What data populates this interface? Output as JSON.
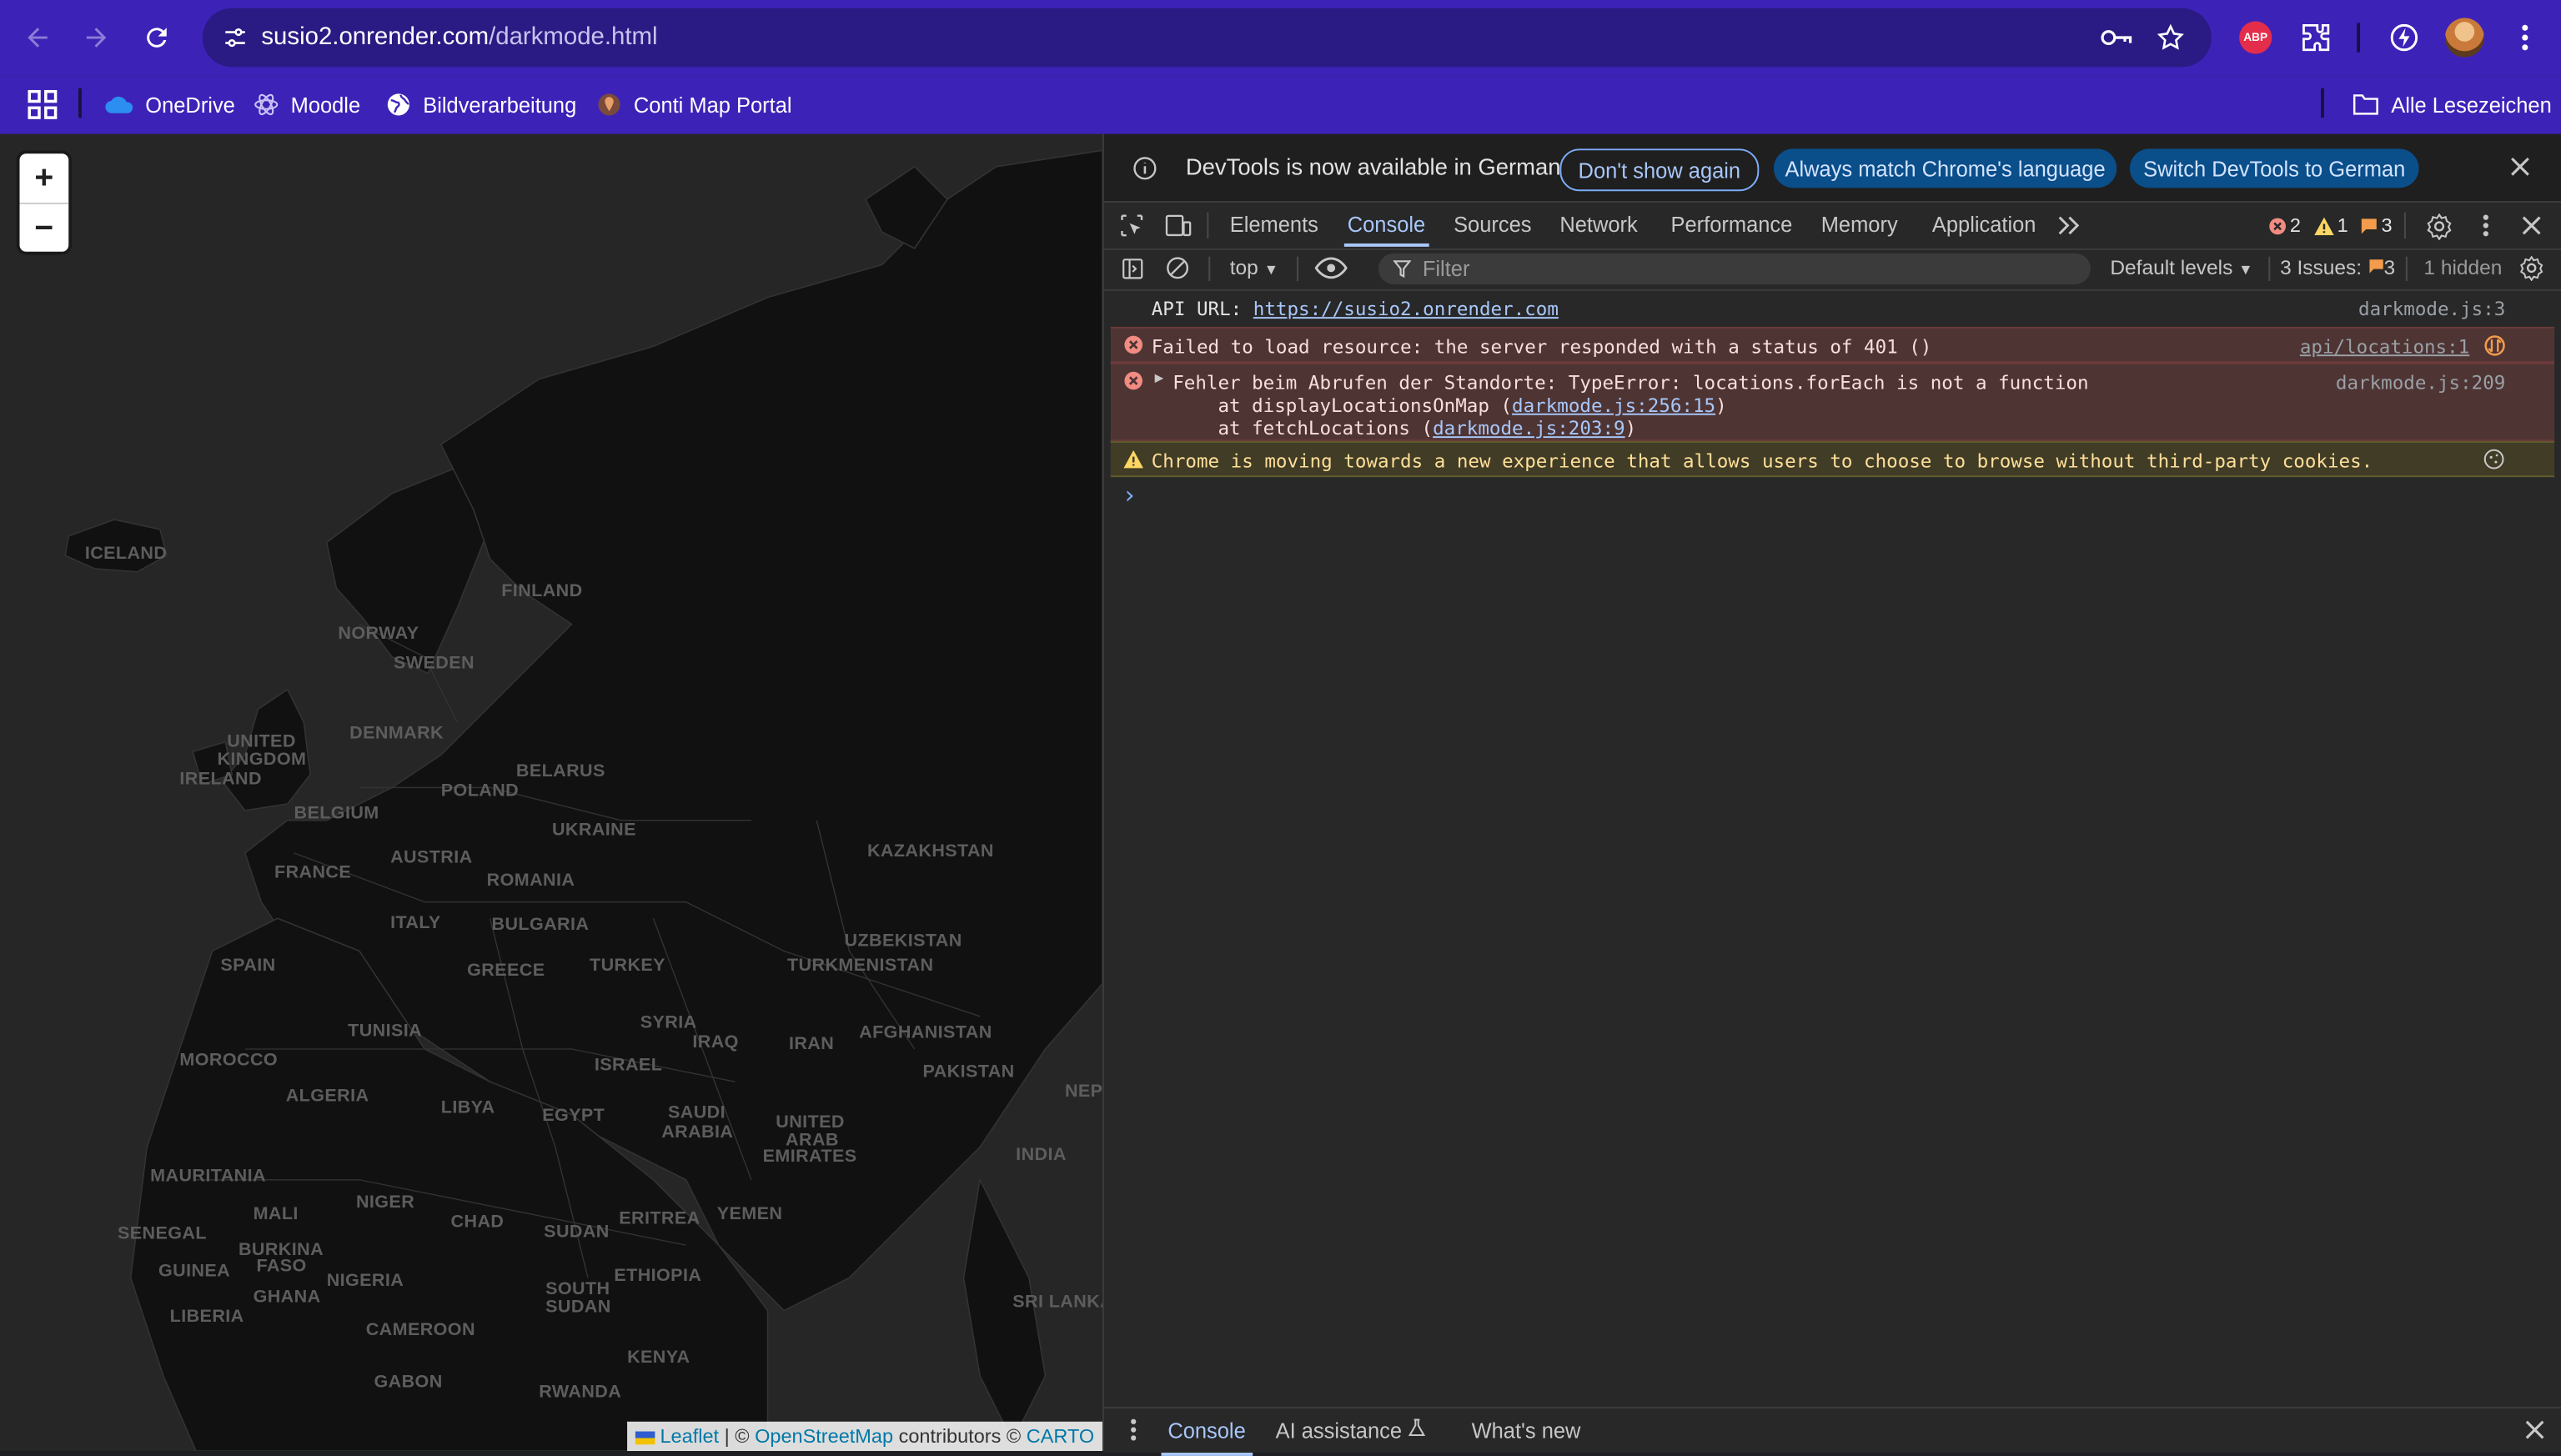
{
  "browser": {
    "url_host": "susio2.onrender.com",
    "url_path": "/darkmode.html",
    "abp_label": "ABP",
    "accent_color": "#3d22b8"
  },
  "bookmarks": {
    "items": [
      {
        "label": "OneDrive",
        "icon": "onedrive-cloud-icon"
      },
      {
        "label": "Moodle",
        "icon": "moodle-icon"
      },
      {
        "label": "Bildverarbeitung",
        "icon": "globe-icon"
      },
      {
        "label": "Conti Map Portal",
        "icon": "map-portal-icon"
      }
    ],
    "all_bookmarks": "Alle Lesezeichen"
  },
  "map": {
    "zoom_in": "+",
    "zoom_out": "−",
    "labels": [
      "ICELAND",
      "FINLAND",
      "NORWAY",
      "SWEDEN",
      "DENMARK",
      "UNITED",
      "KINGDOM",
      "IRELAND",
      "BELARUS",
      "POLAND",
      "BELGIUM",
      "UKRAINE",
      "AUSTRIA",
      "FRANCE",
      "ROMANIA",
      "ITALY",
      "BULGARIA",
      "KAZAKHSTAN",
      "UZBEKISTAN",
      "TURKMENISTAN",
      "SPAIN",
      "GREECE",
      "TURKEY",
      "TUNISIA",
      "SYRIA",
      "IRAQ",
      "IRAN",
      "AFGHANISTAN",
      "PAKISTAN",
      "ISRAEL",
      "MOROCCO",
      "ALGERIA",
      "LIBYA",
      "EGYPT",
      "SAUDI",
      "ARABIA",
      "UNITED",
      "ARAB",
      "EMIRATES",
      "NEP",
      "INDIA",
      "MAURITANIA",
      "MALI",
      "NIGER",
      "CHAD",
      "SUDAN",
      "ERITREA",
      "YEMEN",
      "SENEGAL",
      "BURKINA",
      "FASO",
      "GUINEA",
      "GHANA",
      "NIGERIA",
      "ETHIOPIA",
      "SOUTH",
      "SUDAN",
      "LIBERIA",
      "CAMEROON",
      "SRI LANKA",
      "KENYA",
      "GABON",
      "RWANDA"
    ],
    "attribution": {
      "leaflet": "Leaflet",
      "sep": "| ©",
      "osm": "OpenStreetMap",
      "contributors": "contributors ©",
      "carto": "CARTO"
    }
  },
  "devtools": {
    "infobar": {
      "message": "DevTools is now available in German",
      "btn_dont_show": "Don't show again",
      "btn_match": "Always match Chrome's language",
      "btn_switch": "Switch DevTools to German"
    },
    "tabs": [
      "Elements",
      "Console",
      "Sources",
      "Network",
      "Performance",
      "Memory",
      "Application"
    ],
    "active_tab": "Console",
    "counts": {
      "errors": "2",
      "warnings": "1",
      "issues": "3"
    },
    "console_bar": {
      "context": "top",
      "filter_placeholder": "Filter",
      "levels": "Default levels",
      "issues_label": "3 Issues:",
      "issues_count": "3",
      "hidden": "1 hidden"
    },
    "messages": {
      "api_label": "API URL: ",
      "api_url": "https://susio2.onrender.com",
      "api_src": "darkmode.js:3",
      "err1": "Failed to load resource: the server responded with a status of 401 ()",
      "err1_src": "api/locations:1",
      "err2_line1": "Fehler beim Abrufen der Standorte: TypeError: locations.forEach is not a function",
      "err2_l2_pre": "    at displayLocationsOnMap (",
      "err2_l2_link": "darkmode.js:256:15",
      "err2_l3_pre": "    at fetchLocations (",
      "err2_l3_link": "darkmode.js:203:9",
      "close_paren": ")",
      "err2_src": "darkmode.js:209",
      "warn": "Chrome is moving towards a new experience that allows users to choose to browse without third-party cookies.",
      "prompt": "›"
    },
    "drawer": {
      "console": "Console",
      "ai": "AI assistance",
      "whats_new": "What's new"
    }
  }
}
